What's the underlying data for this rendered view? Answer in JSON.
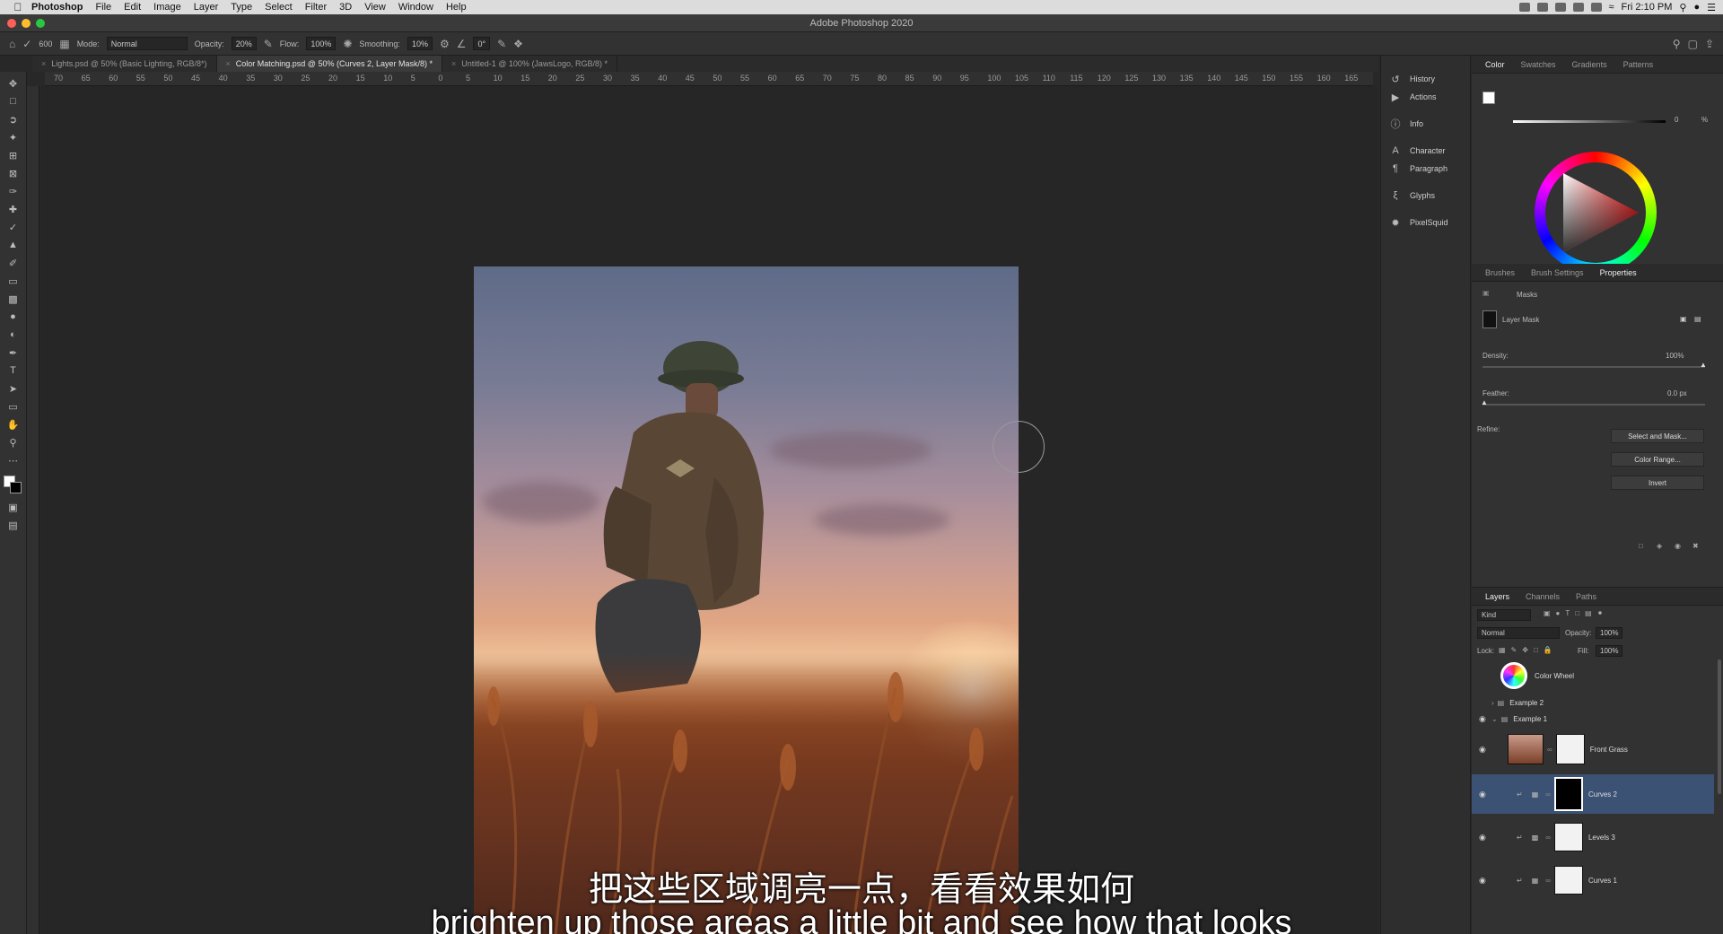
{
  "menubar": {
    "app": "Photoshop",
    "items": [
      "File",
      "Edit",
      "Image",
      "Layer",
      "Type",
      "Select",
      "Filter",
      "3D",
      "View",
      "Window",
      "Help"
    ],
    "clock": "Fri 2:10 PM"
  },
  "window_title": "Adobe Photoshop 2020",
  "options": {
    "brush_size": "600",
    "mode_label": "Mode:",
    "mode_value": "Normal",
    "opacity_label": "Opacity:",
    "opacity_value": "20%",
    "flow_label": "Flow:",
    "flow_value": "100%",
    "smoothing_label": "Smoothing:",
    "smoothing_value": "10%",
    "angle_value": "0°"
  },
  "tabs": [
    {
      "label": "Lights.psd @ 50% (Basic Lighting, RGB/8*)",
      "active": false
    },
    {
      "label": "Color Matching.psd @ 50% (Curves 2, Layer Mask/8) *",
      "active": true
    },
    {
      "label": "Untitled-1 @ 100% (JawsLogo, RGB/8) *",
      "active": false
    }
  ],
  "ruler_labels": [
    "70",
    "65",
    "60",
    "55",
    "50",
    "45",
    "40",
    "35",
    "30",
    "25",
    "20",
    "15",
    "10",
    "5",
    "0",
    "5",
    "10",
    "15",
    "20",
    "25",
    "30",
    "35",
    "40",
    "45",
    "50",
    "55",
    "60",
    "65",
    "70",
    "75",
    "80",
    "85",
    "90",
    "95",
    "100",
    "105",
    "110",
    "115",
    "120",
    "125",
    "130",
    "135",
    "140",
    "145",
    "150",
    "155",
    "160",
    "165"
  ],
  "collapsed_panels": [
    {
      "label": "History",
      "icon": "history-icon"
    },
    {
      "label": "Actions",
      "icon": "play-icon"
    },
    {
      "label": "Info",
      "icon": "info-icon"
    },
    {
      "label": "Character",
      "icon": "character-icon"
    },
    {
      "label": "Paragraph",
      "icon": "paragraph-icon"
    },
    {
      "label": "Glyphs",
      "icon": "glyphs-icon"
    },
    {
      "label": "PixelSquid",
      "icon": "pixelsquid-icon"
    }
  ],
  "color_tabs": [
    "Color",
    "Swatches",
    "Gradients",
    "Patterns"
  ],
  "color_slider_value": "0",
  "color_slider_unit": "%",
  "props_tabs": [
    "Brushes",
    "Brush Settings",
    "Properties"
  ],
  "properties": {
    "section": "Masks",
    "mask_name": "Layer Mask",
    "density_label": "Density:",
    "density_value": "100%",
    "feather_label": "Feather:",
    "feather_value": "0.0 px",
    "refine_label": "Refine:",
    "btn_select_mask": "Select and Mask...",
    "btn_color_range": "Color Range...",
    "btn_invert": "Invert"
  },
  "layers_tabs": [
    "Layers",
    "Channels",
    "Paths"
  ],
  "layers_controls": {
    "kind": "Kind",
    "blend": "Normal",
    "opacity_label": "Opacity:",
    "opacity_value": "100%",
    "lock_label": "Lock:",
    "fill_label": "Fill:",
    "fill_value": "100%"
  },
  "layers": [
    {
      "name": "Color Wheel",
      "type": "image",
      "selected": false
    },
    {
      "name": "Example 2",
      "type": "group",
      "selected": false
    },
    {
      "name": "Example 1",
      "type": "group",
      "selected": false
    },
    {
      "name": "Front Grass",
      "type": "image",
      "selected": false
    },
    {
      "name": "Curves 2",
      "type": "adjustment",
      "selected": true
    },
    {
      "name": "Levels 3",
      "type": "adjustment",
      "selected": false
    },
    {
      "name": "Curves 1",
      "type": "adjustment",
      "selected": false
    }
  ],
  "subtitles": {
    "cn": "把这些区域调亮一点，看看效果如何",
    "en": "brighten up those areas a little bit and see how that looks"
  }
}
